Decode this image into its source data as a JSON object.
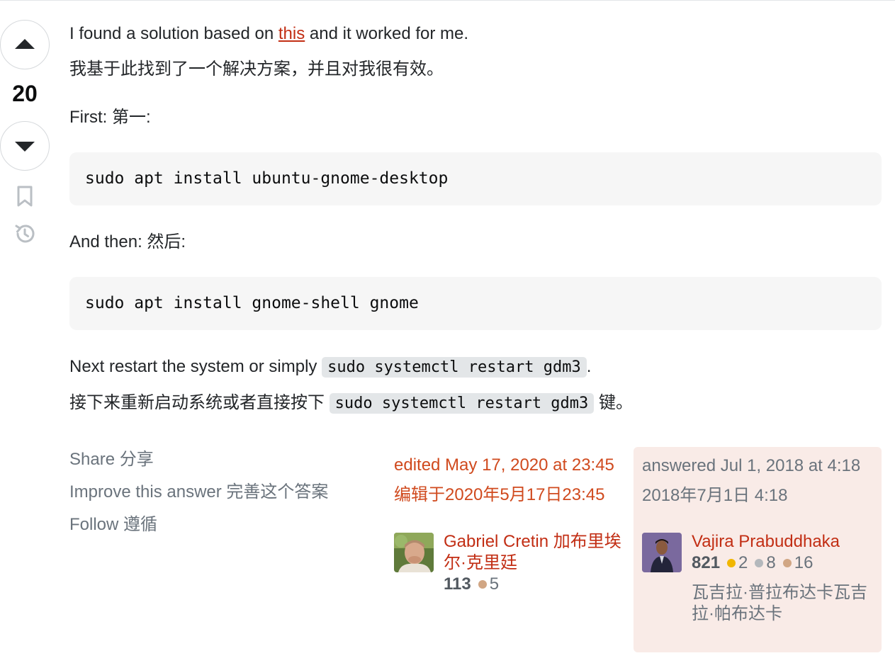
{
  "vote": {
    "count": "20",
    "upvote_icon": "upvote-arrow-icon",
    "downvote_icon": "downvote-arrow-icon",
    "bookmark_icon": "bookmark-icon",
    "history_icon": "history-icon"
  },
  "post": {
    "line1_before": "I found a solution based on ",
    "line1_link": "this",
    "line1_after": " and it worked for me.",
    "line2": "我基于此找到了一个解决方案，并且对我很有效。",
    "first_label": "First: 第一:",
    "code1": "sudo apt install ubuntu-gnome-desktop",
    "then_label": "And then: 然后:",
    "code2": "sudo apt install gnome-shell gnome",
    "next_before": "Next restart the system or simply ",
    "next_code": "sudo systemctl restart gdm3",
    "next_after": ".",
    "cn_before": "接下来重新启动系统或者直接按下 ",
    "cn_code": "sudo systemctl restart gdm3",
    "cn_after": " 键。"
  },
  "menu": {
    "share": "Share 分享",
    "improve": "Improve this answer 完善这个答案",
    "follow": "Follow 遵循"
  },
  "edited": {
    "en": "edited May 17, 2020 at 23:45",
    "cn": "编辑于2020年5月17日23:45",
    "user": {
      "name": "Gabriel Cretin 加布里埃尔·克里廷",
      "reputation": "113",
      "bronze": "5"
    }
  },
  "answered": {
    "en": "answered Jul 1, 2018 at 4:18",
    "cn": "2018年7月1日 4:18",
    "user": {
      "name": "Vajira Prabuddhaka",
      "reputation": "821",
      "gold": "2",
      "silver": "8",
      "bronze": "16",
      "name_cn": "瓦吉拉·普拉布达卡瓦吉拉·帕布达卡"
    }
  },
  "colors": {
    "link": "#c22e14",
    "edited": "#d04a1e",
    "answer_card_bg": "#f9ebe7",
    "gold": "#f1b600",
    "silver": "#b4b8bc",
    "bronze": "#d1a684"
  }
}
